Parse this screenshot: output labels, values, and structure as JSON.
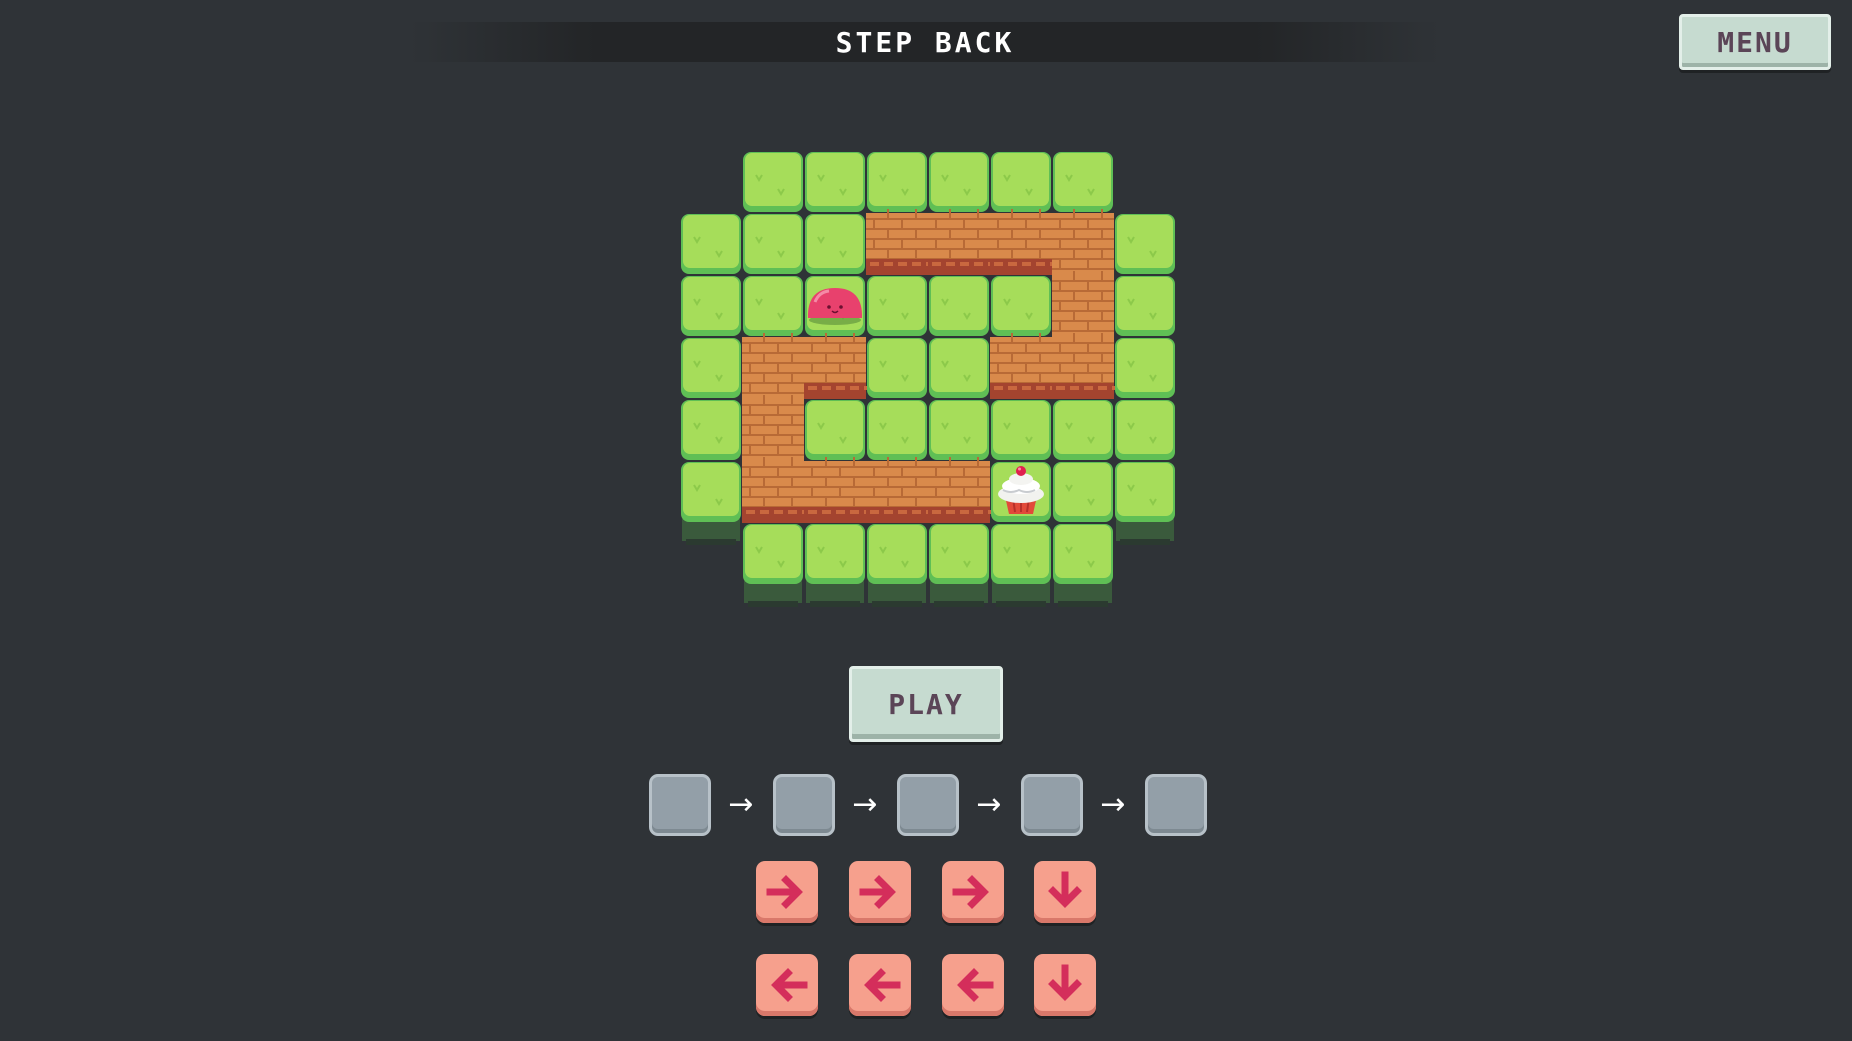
{
  "header": {
    "title": "STEP BACK"
  },
  "menu": {
    "label": "MENU"
  },
  "play": {
    "label": "PLAY"
  },
  "colors": {
    "background": "#2f3337",
    "grass": "#a6dd5a",
    "brick": "#d98a4b",
    "slime": "#e8416d",
    "button_pink": "#f6a08d",
    "arrow": "#d42e5b",
    "slot": "#939fa8",
    "panel": "#c6dbd0"
  },
  "board": {
    "cols": 8,
    "rows": 7,
    "tiles": [
      "-GGGGGG-",
      "GGGBBBBG",
      "GGGGGGBG",
      "GBBGGBBG",
      "GBGGGGGG",
      "GBBBBGGG",
      "-GGGGGG-"
    ],
    "player": {
      "name": "slime",
      "col": 2,
      "row": 2
    },
    "goal": {
      "name": "cupcake",
      "col": 5,
      "row": 5
    }
  },
  "program": {
    "slot_count": 5,
    "slot_connector_icon": "arrow-right-icon"
  },
  "move_buttons": [
    {
      "direction": "right",
      "icon": "arrow-right-icon"
    },
    {
      "direction": "right",
      "icon": "arrow-right-icon"
    },
    {
      "direction": "right",
      "icon": "arrow-right-icon"
    },
    {
      "direction": "down",
      "icon": "arrow-down-icon"
    },
    {
      "direction": "left",
      "icon": "arrow-left-icon"
    },
    {
      "direction": "left",
      "icon": "arrow-left-icon"
    },
    {
      "direction": "left",
      "icon": "arrow-left-icon"
    },
    {
      "direction": "down",
      "icon": "arrow-down-icon"
    }
  ]
}
